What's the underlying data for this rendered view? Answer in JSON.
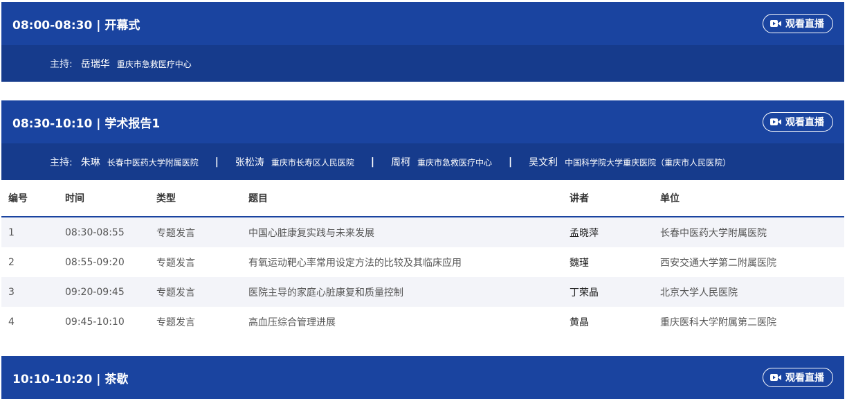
{
  "sessions": [
    {
      "time_title": "08:00-08:30 | 开幕式",
      "live_label": "观看直播",
      "hosts_label": "主持:",
      "hosts": [
        {
          "name": "岳瑞华",
          "org": "重庆市急救医疗中心"
        }
      ]
    },
    {
      "time_title": "08:30-10:10 | 学术报告1",
      "live_label": "观看直播",
      "hosts_label": "主持:",
      "hosts": [
        {
          "name": "朱琳",
          "org": "长春中医药大学附属医院"
        },
        {
          "name": "张松涛",
          "org": "重庆市长寿区人民医院"
        },
        {
          "name": "周柯",
          "org": "重庆市急救医疗中心"
        },
        {
          "name": "吴文利",
          "org": "中国科学院大学重庆医院（重庆市人民医院）"
        }
      ],
      "separator": "|"
    },
    {
      "time_title": "10:10-10:20 | 茶歇",
      "live_label": "观看直播"
    }
  ],
  "table": {
    "headers": [
      "编号",
      "时间",
      "类型",
      "题目",
      "讲者",
      "单位"
    ],
    "rows": [
      {
        "no": "1",
        "time": "08:30-08:55",
        "type": "专题发言",
        "topic": "中国心脏康复实践与未来发展",
        "speaker": "孟晓萍",
        "org": "长春中医药大学附属医院"
      },
      {
        "no": "2",
        "time": "08:55-09:20",
        "type": "专题发言",
        "topic": "有氧运动靶心率常用设定方法的比较及其临床应用",
        "speaker": "魏瑾",
        "org": "西安交通大学第二附属医院"
      },
      {
        "no": "3",
        "time": "09:20-09:45",
        "type": "专题发言",
        "topic": "医院主导的家庭心脏康复和质量控制",
        "speaker": "丁荣晶",
        "org": "北京大学人民医院"
      },
      {
        "no": "4",
        "time": "09:45-10:10",
        "type": "专题发言",
        "topic": "高血压综合管理进展",
        "speaker": "黄晶",
        "org": "重庆医科大学附属第二医院"
      }
    ]
  },
  "colors": {
    "header_bg": "#1a44a0",
    "hosts_bg": "#163b8c",
    "row_alt": "#f3f4f9"
  },
  "icons": {
    "live": "video-camera-icon"
  }
}
